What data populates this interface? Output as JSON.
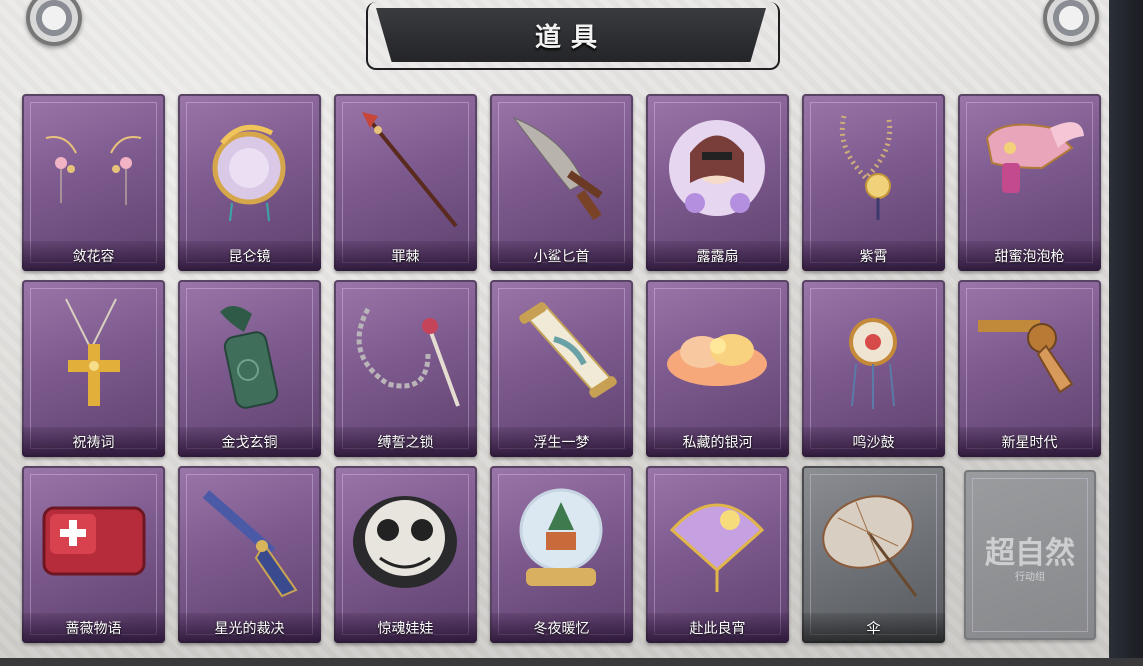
{
  "header": {
    "title": "道具"
  },
  "items": [
    {
      "name": "敛花容",
      "icon": "hairpin-icon"
    },
    {
      "name": "昆仑镜",
      "icon": "mirror-icon"
    },
    {
      "name": "罪棘",
      "icon": "spear-icon"
    },
    {
      "name": "小鲨匕首",
      "icon": "shark-dagger-icon"
    },
    {
      "name": "露露扇",
      "icon": "girl-fan-icon"
    },
    {
      "name": "紫霄",
      "icon": "beads-icon"
    },
    {
      "name": "甜蜜泡泡枪",
      "icon": "bubble-gun-icon"
    },
    {
      "name": "祝祷词",
      "icon": "cross-icon"
    },
    {
      "name": "金戈玄铜",
      "icon": "bronze-grenade-icon"
    },
    {
      "name": "缚誓之锁",
      "icon": "chain-icon"
    },
    {
      "name": "浮生一梦",
      "icon": "scroll-icon"
    },
    {
      "name": "私藏的银河",
      "icon": "cloud-icon"
    },
    {
      "name": "鸣沙鼓",
      "icon": "drum-icon"
    },
    {
      "name": "新星时代",
      "icon": "revolver-icon"
    },
    {
      "name": "蔷薇物语",
      "icon": "medkit-icon"
    },
    {
      "name": "星光的裁决",
      "icon": "flintlock-icon"
    },
    {
      "name": "惊魂娃娃",
      "icon": "skull-doll-icon"
    },
    {
      "name": "冬夜暖忆",
      "icon": "snow-globe-icon"
    },
    {
      "name": "赴此良宵",
      "icon": "golden-fan-icon"
    },
    {
      "name": "伞",
      "icon": "umbrella-icon"
    }
  ],
  "locked_slot": {
    "text": "超自然",
    "subtext": "行动组"
  },
  "colors": {
    "card_purple": "#7d5a8e",
    "card_grey": "#6f7277",
    "banner": "#2f3034"
  }
}
